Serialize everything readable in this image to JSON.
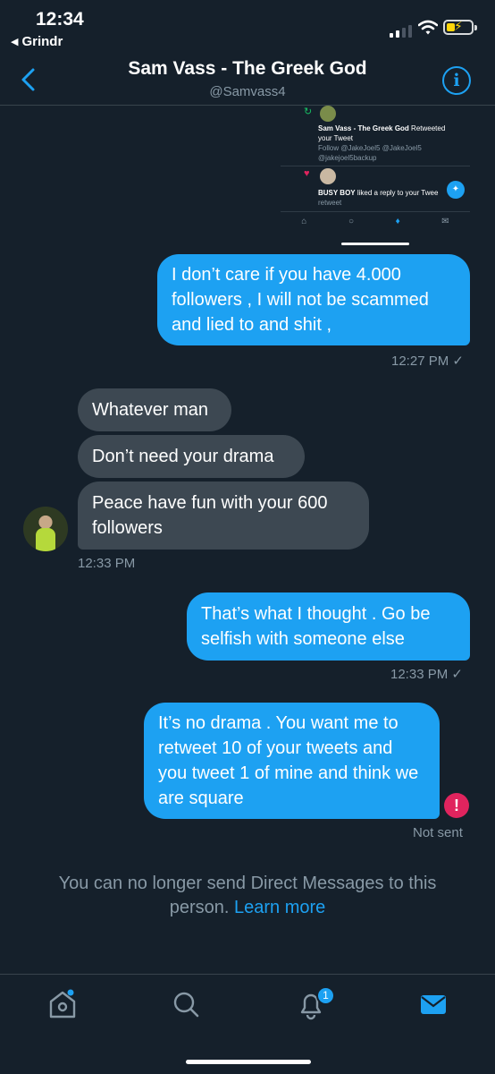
{
  "status_bar": {
    "time": "12:34",
    "back_app": "Grindr"
  },
  "header": {
    "title": "Sam Vass - The Greek God",
    "handle": "@Samvass4"
  },
  "embedded_screenshot": {
    "notif1_name": "Sam Vass - The Greek God",
    "notif1_action": " Retweeted your Tweet",
    "notif1_sub1": "Follow @JakeJoel5 @JakeJoel5",
    "notif1_sub2": "@jakejoel5backup",
    "notif2_name": "BUSY BOY",
    "notif2_action": " liked a reply to your Twee",
    "notif2_sub": "retweet"
  },
  "messages": [
    {
      "text": "I don’t care if you have 4.000 followers , I will not be scammed and lied to and shit ,",
      "direction": "sent"
    },
    {
      "text": "Whatever man",
      "direction": "received"
    },
    {
      "text": "Don’t need your drama",
      "direction": "received"
    },
    {
      "text": "Peace have fun with your 600 followers",
      "direction": "received"
    },
    {
      "text": "That’s what I thought . Go be selfish with someone else",
      "direction": "sent"
    },
    {
      "text": "It’s no drama . You want me to retweet 10 of your tweets and you tweet 1 of mine and think we are square",
      "direction": "sent"
    }
  ],
  "timestamps": {
    "t1": "12:27 PM ✓",
    "t2": "12:33 PM",
    "t3": "12:33 PM ✓",
    "not_sent": "Not sent"
  },
  "blocked_notice": {
    "text": "You can no longer send Direct Messages to this person.",
    "link": "Learn more"
  },
  "tabbar": {
    "notifications_badge": "1"
  },
  "colors": {
    "background": "#15202b",
    "sent_bubble": "#1da1f2",
    "received_bubble": "#3d4852",
    "error": "#e0245e"
  }
}
